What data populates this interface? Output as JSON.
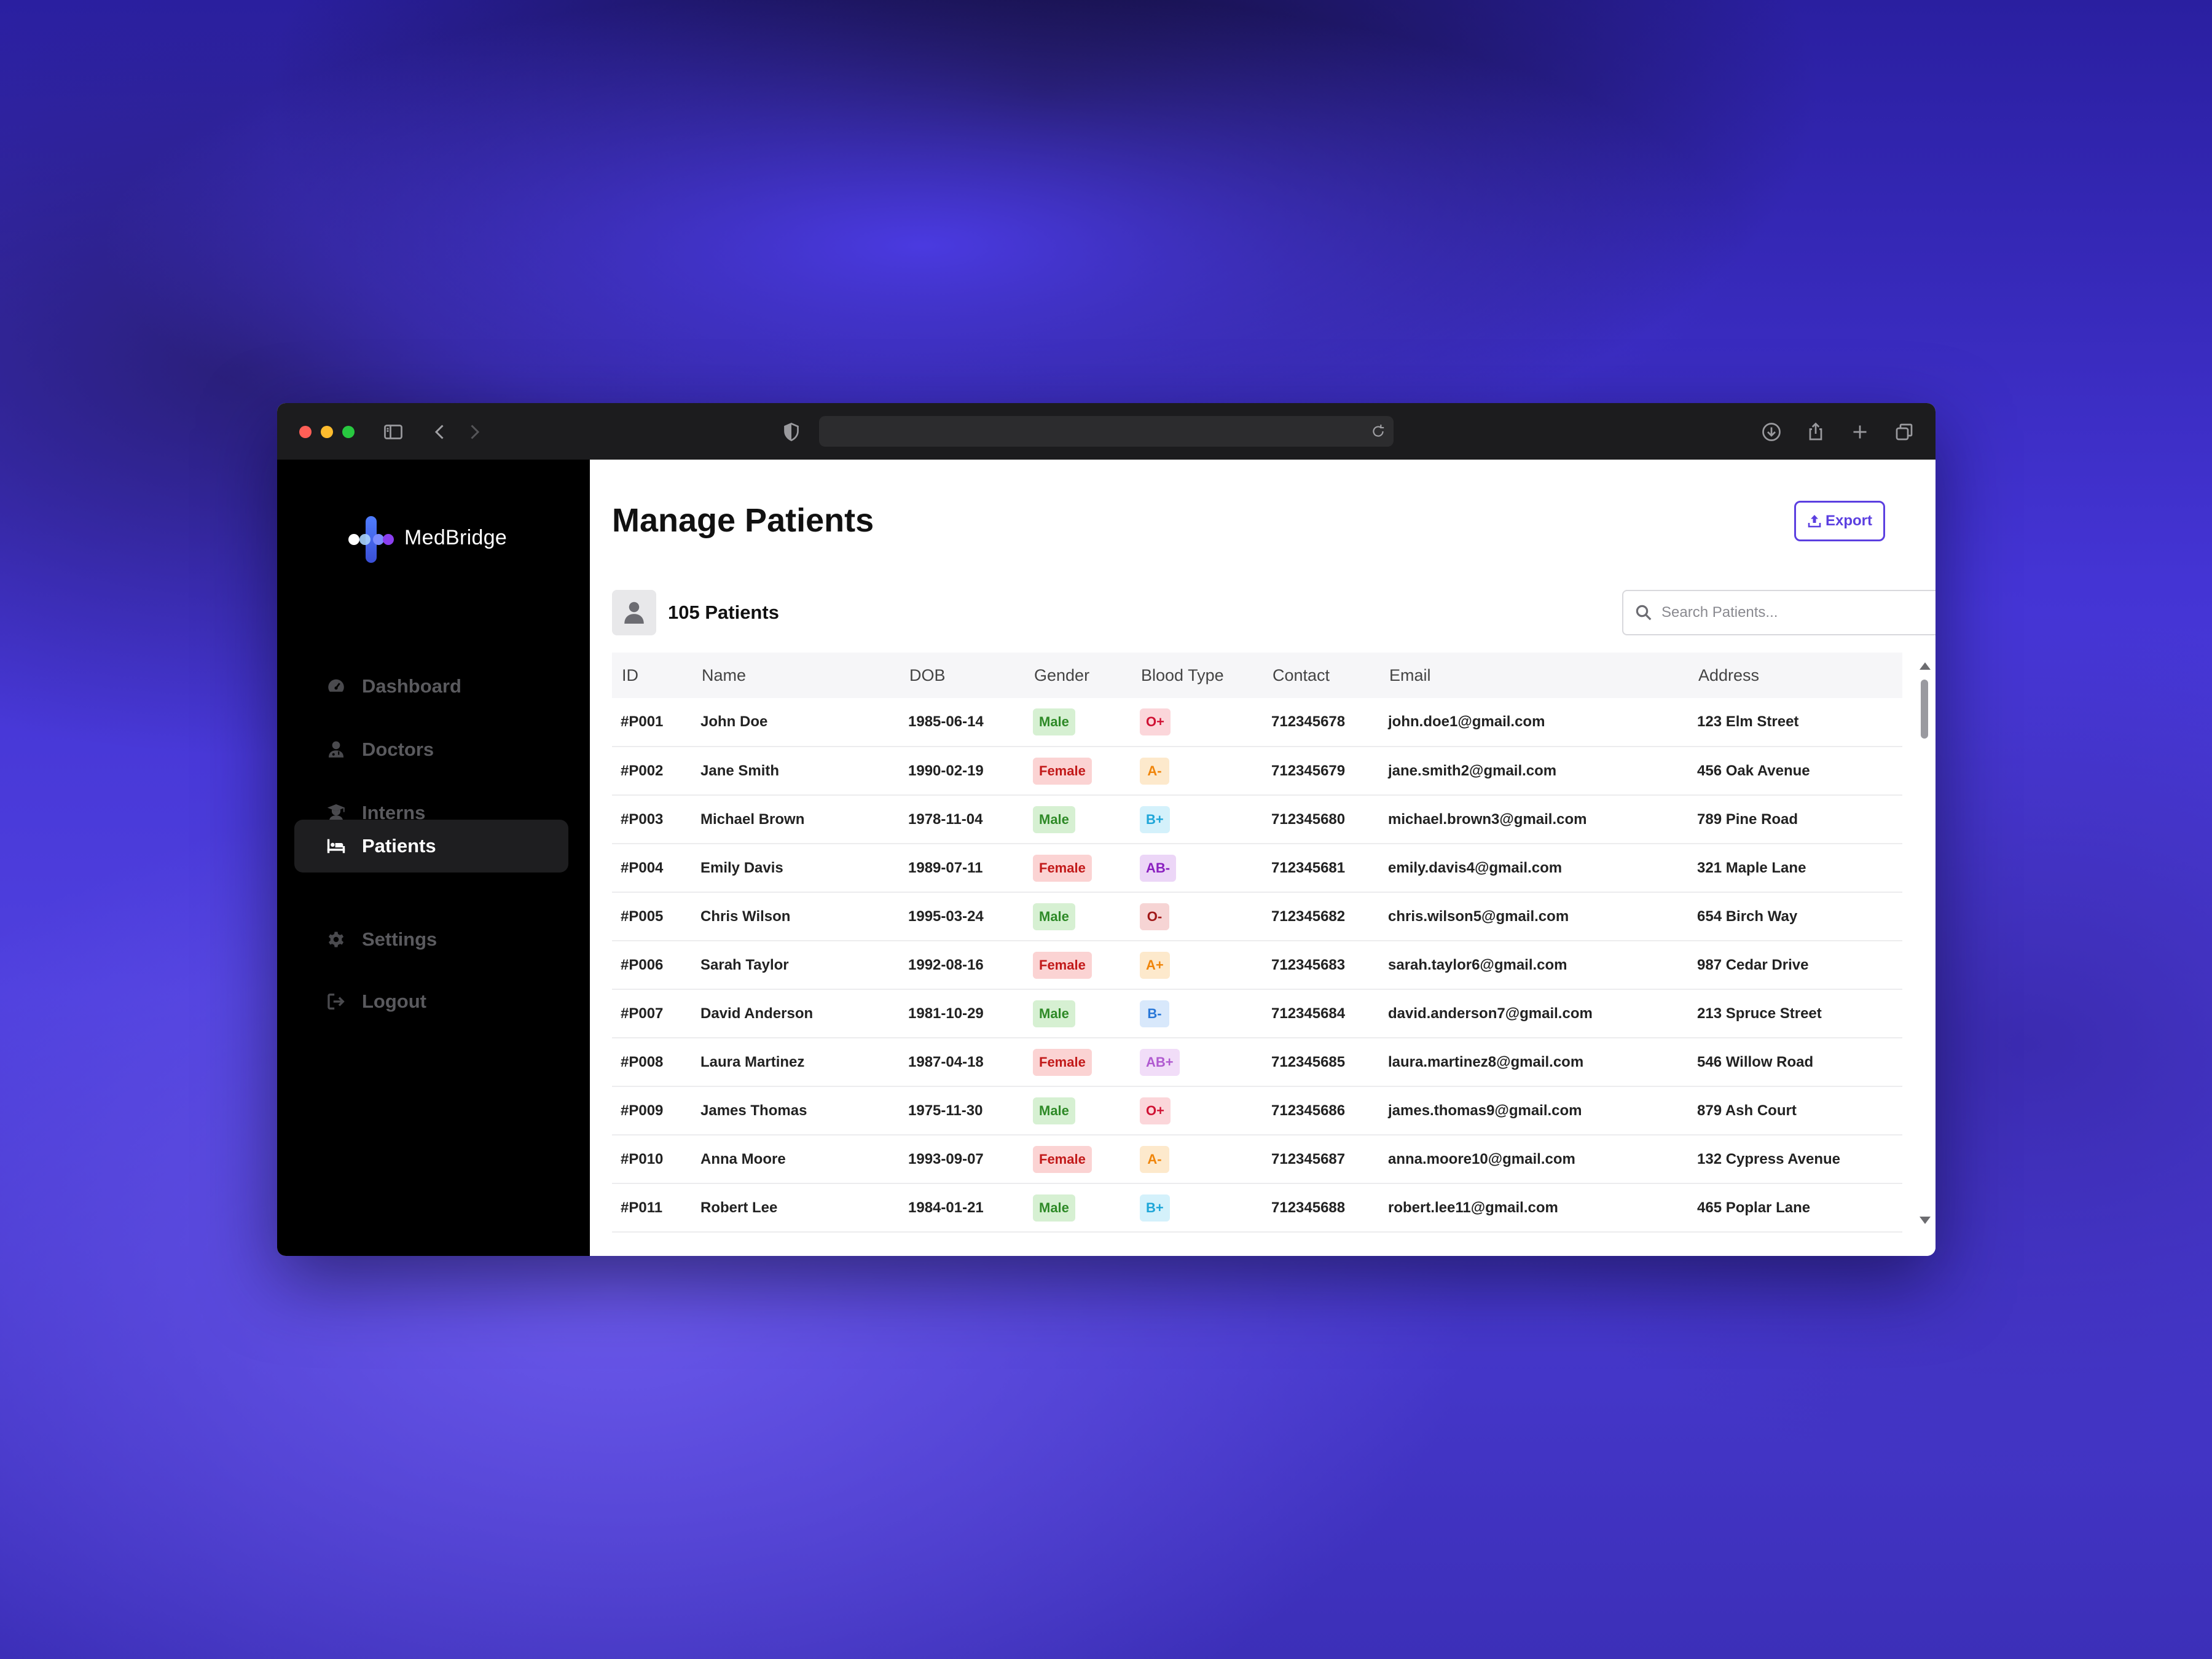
{
  "app": {
    "brand": "MedBridge",
    "colors": {
      "accent": "#5b3fe0",
      "sidebar_bg": "#000000",
      "active_nav_bg": "#1e1e20"
    }
  },
  "sidebar": {
    "items": [
      {
        "label": "Dashboard",
        "icon": "dashboard-gauge-icon",
        "active": false
      },
      {
        "label": "Doctors",
        "icon": "doctor-icon",
        "active": false
      },
      {
        "label": "Interns",
        "icon": "graduate-icon",
        "active": false
      },
      {
        "label": "Patients",
        "icon": "hospital-bed-icon",
        "active": true
      },
      {
        "label": "Settings",
        "icon": "gear-icon",
        "active": false
      },
      {
        "label": "Logout",
        "icon": "logout-icon",
        "active": false
      }
    ]
  },
  "header": {
    "title": "Manage Patients",
    "export_label": "Export"
  },
  "summary": {
    "count_label": "105 Patients"
  },
  "search": {
    "placeholder": "Search Patients..."
  },
  "table": {
    "columns": [
      "ID",
      "Name",
      "DOB",
      "Gender",
      "Blood Type",
      "Contact",
      "Email",
      "Address"
    ],
    "rows": [
      {
        "id": "#P001",
        "name": "John Doe",
        "dob": "1985-06-14",
        "gender": "Male",
        "blood": "O+",
        "contact": "712345678",
        "email": "john.doe1@gmail.com",
        "address": "123 Elm Street"
      },
      {
        "id": "#P002",
        "name": "Jane Smith",
        "dob": "1990-02-19",
        "gender": "Female",
        "blood": "A-",
        "contact": "712345679",
        "email": "jane.smith2@gmail.com",
        "address": "456 Oak Avenue"
      },
      {
        "id": "#P003",
        "name": "Michael Brown",
        "dob": "1978-11-04",
        "gender": "Male",
        "blood": "B+",
        "contact": "712345680",
        "email": "michael.brown3@gmail.com",
        "address": "789 Pine Road"
      },
      {
        "id": "#P004",
        "name": "Emily Davis",
        "dob": "1989-07-11",
        "gender": "Female",
        "blood": "AB-",
        "contact": "712345681",
        "email": "emily.davis4@gmail.com",
        "address": "321 Maple Lane"
      },
      {
        "id": "#P005",
        "name": "Chris Wilson",
        "dob": "1995-03-24",
        "gender": "Male",
        "blood": "O-",
        "contact": "712345682",
        "email": "chris.wilson5@gmail.com",
        "address": "654 Birch Way"
      },
      {
        "id": "#P006",
        "name": "Sarah Taylor",
        "dob": "1992-08-16",
        "gender": "Female",
        "blood": "A+",
        "contact": "712345683",
        "email": "sarah.taylor6@gmail.com",
        "address": "987 Cedar Drive"
      },
      {
        "id": "#P007",
        "name": "David Anderson",
        "dob": "1981-10-29",
        "gender": "Male",
        "blood": "B-",
        "contact": "712345684",
        "email": "david.anderson7@gmail.com",
        "address": "213 Spruce Street"
      },
      {
        "id": "#P008",
        "name": "Laura Martinez",
        "dob": "1987-04-18",
        "gender": "Female",
        "blood": "AB+",
        "contact": "712345685",
        "email": "laura.martinez8@gmail.com",
        "address": "546 Willow Road"
      },
      {
        "id": "#P009",
        "name": "James Thomas",
        "dob": "1975-11-30",
        "gender": "Male",
        "blood": "O+",
        "contact": "712345686",
        "email": "james.thomas9@gmail.com",
        "address": "879 Ash Court"
      },
      {
        "id": "#P010",
        "name": "Anna Moore",
        "dob": "1993-09-07",
        "gender": "Female",
        "blood": "A-",
        "contact": "712345687",
        "email": "anna.moore10@gmail.com",
        "address": "132 Cypress Avenue"
      },
      {
        "id": "#P011",
        "name": "Robert Lee",
        "dob": "1984-01-21",
        "gender": "Male",
        "blood": "B+",
        "contact": "712345688",
        "email": "robert.lee11@gmail.com",
        "address": "465 Poplar Lane"
      }
    ]
  }
}
